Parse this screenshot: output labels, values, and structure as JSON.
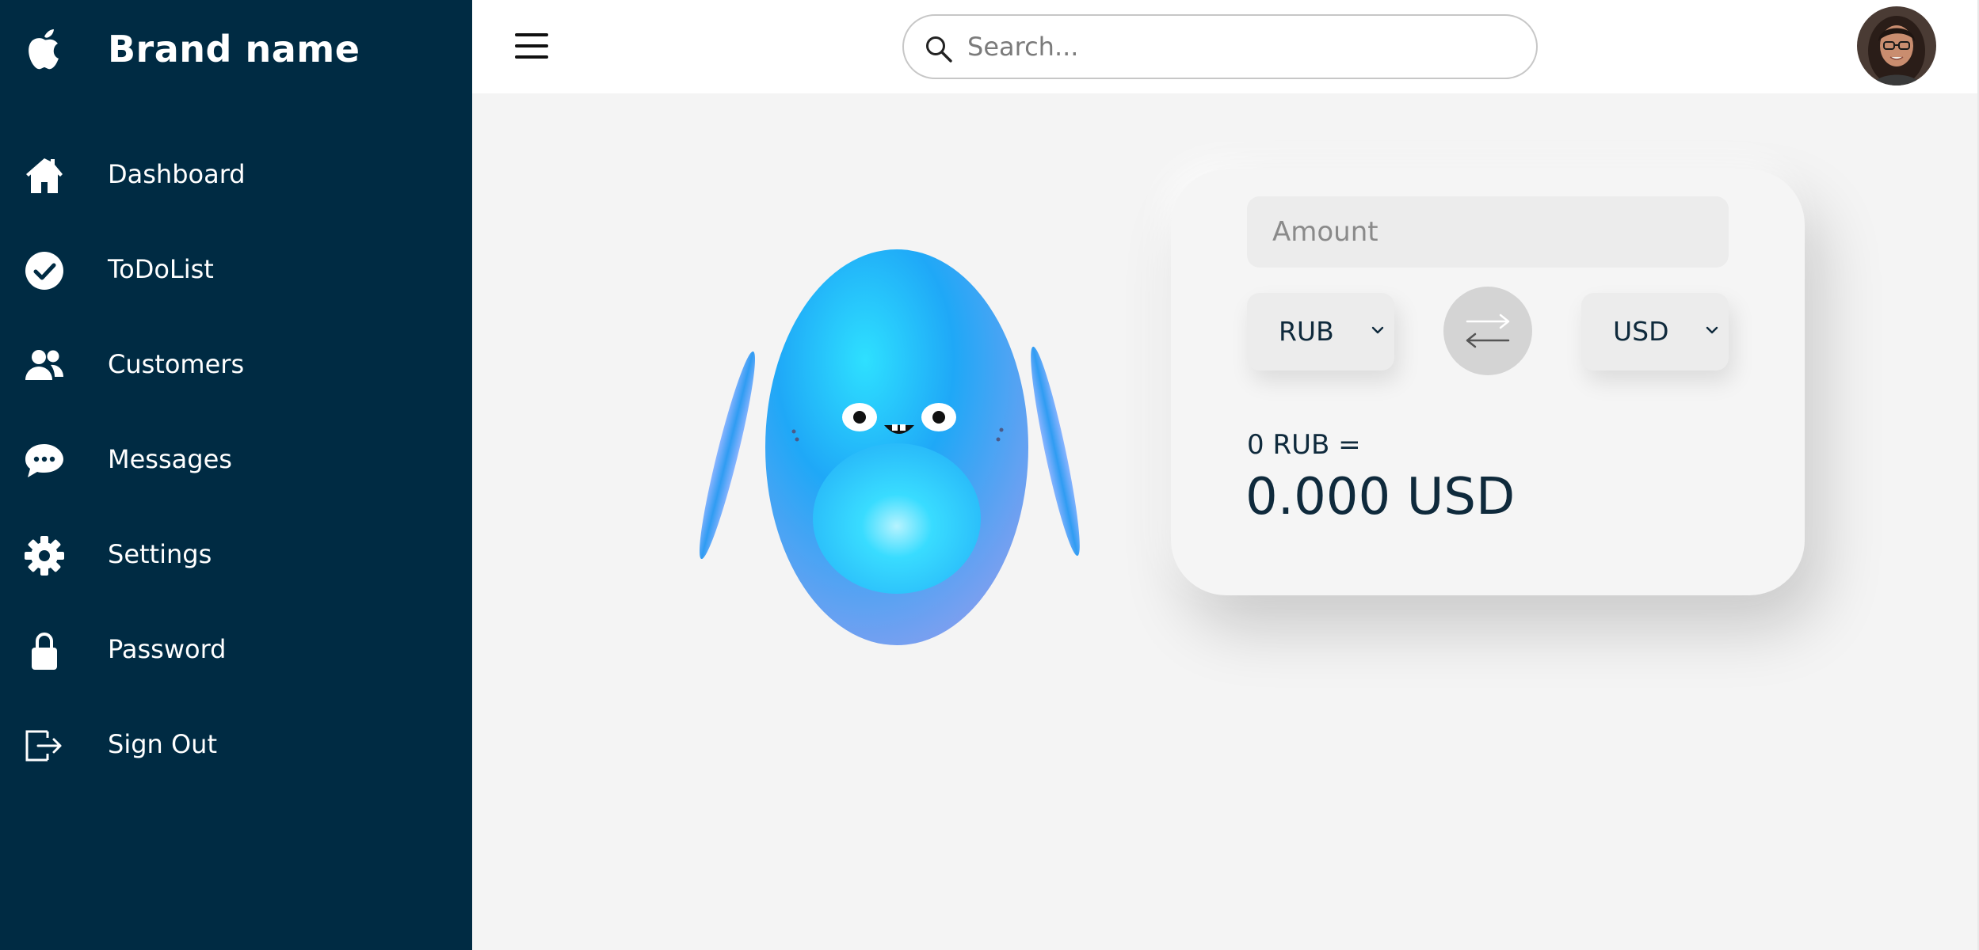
{
  "brand": {
    "name": "Brand name",
    "logo_icon": "apple-logo-icon"
  },
  "sidebar": {
    "items": [
      {
        "label": "Dashboard",
        "icon": "home-icon"
      },
      {
        "label": "ToDoList",
        "icon": "check-circle-icon"
      },
      {
        "label": "Customers",
        "icon": "users-icon"
      },
      {
        "label": "Messages",
        "icon": "chat-bubble-icon"
      },
      {
        "label": "Settings",
        "icon": "gear-icon"
      },
      {
        "label": "Password",
        "icon": "lock-icon"
      },
      {
        "label": "Sign Out",
        "icon": "sign-out-icon"
      }
    ]
  },
  "header": {
    "menu_icon": "hamburger-menu-icon",
    "search": {
      "placeholder": "Search...",
      "value": "",
      "icon": "search-icon"
    }
  },
  "converter": {
    "amount": {
      "placeholder": "Amount",
      "value": ""
    },
    "from_currency": "RUB",
    "to_currency": "USD",
    "swap_icon": "swap-arrows-icon",
    "from_text": "0 RUB =",
    "to_text": "0.000 USD"
  },
  "colors": {
    "sidebar_bg": "#002b43",
    "page_bg": "#f4f4f4",
    "text_dark": "#0f2a3c",
    "mascot_blue": "#2aa6f5"
  }
}
